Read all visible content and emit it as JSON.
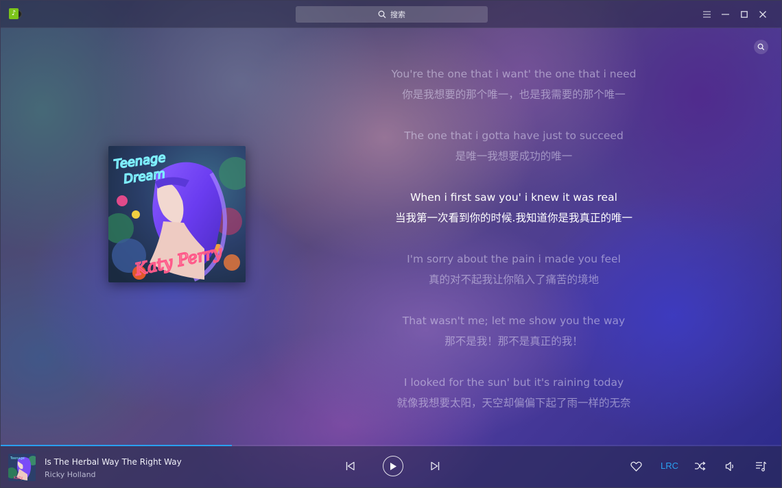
{
  "titlebar": {
    "search_placeholder": "搜索",
    "icons": [
      "app-logo-icon",
      "search-icon",
      "menu-icon",
      "minimize-icon",
      "maximize-icon",
      "close-icon"
    ]
  },
  "lyrics": [
    {
      "en": "You're the one that i want' the one that i need",
      "zh": "你是我想要的那个唯一，也是我需要的那个唯一",
      "active": false
    },
    {
      "en": "The one that i gotta have just to succeed",
      "zh": "是唯一我想要成功的唯一",
      "active": false
    },
    {
      "en": "When i first saw you' i knew it was real",
      "zh": "当我第一次看到你的时候.我知道你是我真正的唯一",
      "active": true
    },
    {
      "en": "I'm sorry about the pain i made you feel",
      "zh": "真的对不起我让你陷入了痛苦的境地",
      "active": false
    },
    {
      "en": "That wasn't me; let me show you the way",
      "zh": "那不是我！那不是真正的我！",
      "active": false
    },
    {
      "en": "I looked for the sun' but it's raining today",
      "zh": "就像我想要太阳，天空却偏偏下起了雨一样的无奈",
      "active": false
    }
  ],
  "album_art": {
    "title_text": "Teenage Dream",
    "artist_text": "Katy Perry"
  },
  "player": {
    "track_title": "Is The Herbal Way The Right Way",
    "artist": "Ricky Holland",
    "progress": 0.296,
    "lrc_label": "LRC",
    "accent_color": "#2aa0f0",
    "icons": [
      "previous-icon",
      "play-icon",
      "next-icon",
      "heart-icon",
      "shuffle-icon",
      "volume-icon",
      "playlist-icon"
    ]
  }
}
